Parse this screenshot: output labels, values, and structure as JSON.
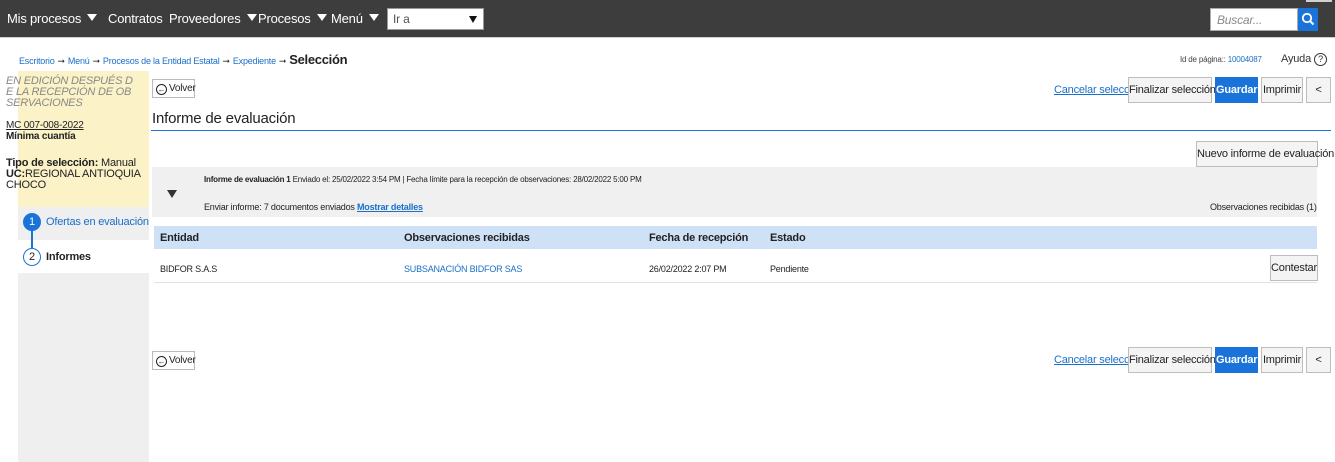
{
  "nav": {
    "items": [
      "Mis procesos",
      "Contratos",
      "Proveedores",
      "Procesos",
      "Menú"
    ],
    "goto_value": "Ir a",
    "search_placeholder": "Buscar..."
  },
  "breadcrumb": {
    "items": [
      "Escritorio",
      "Menú",
      "Procesos de la Entidad Estatal",
      "Expediente"
    ],
    "separator": "➞",
    "current": "Selección"
  },
  "page_id": {
    "label": "Id de página::",
    "value": "10004087"
  },
  "help_label": "Ayuda",
  "help_symbol": "?",
  "info": {
    "status": "EN EDICIÓN DESPUÉS DE LA RECEPCIÓN DE OBSERVACIONES",
    "code": "MC 007-008-2022",
    "modality": "Mínima cuantía",
    "selection_label": "Tipo de selección:",
    "selection_value": "Manual",
    "uc_label": "UC:",
    "uc_value": "REGIONAL ANTIOQUIA CHOCO"
  },
  "steps": [
    {
      "number": "1",
      "label": "Ofertas en evaluación"
    },
    {
      "number": "2",
      "label": "Informes"
    }
  ],
  "actions": {
    "back": "Volver",
    "back_icon": "←",
    "cancel": "Cancelar selección",
    "finalize": "Finalizar selección",
    "save": "Guardar",
    "print": "Imprimir",
    "collapse": "<"
  },
  "section_title": "Informe de evaluación",
  "new_report_button": "Nuevo informe de evaluación",
  "report": {
    "title": "Informe de evaluación 1",
    "sent_text": "Enviado el: 25/02/2022 3:54 PM | Fecha límite para la recepción de observaciones: 28/02/2022 5:00 PM",
    "send_label": "Enviar informe: 7 documentos enviados",
    "details_link": "Mostrar detalles",
    "observations_count": "Observaciones recibidas (1)"
  },
  "table": {
    "headers": [
      "Entidad",
      "Observaciones recibidas",
      "Fecha de recepción",
      "Estado"
    ],
    "rows": [
      {
        "entity": "BIDFOR S.A.S",
        "observation": "SUBSANACIÓN BIDFOR SAS",
        "date": "26/02/2022 2:07 PM",
        "status": "Pendiente",
        "action": "Contestar"
      }
    ]
  },
  "colors": {
    "topbar": "#3d3d3d",
    "primary": "#1a73d9",
    "info_panel": "#fbf2c7",
    "table_header": "#cfe1f7"
  }
}
